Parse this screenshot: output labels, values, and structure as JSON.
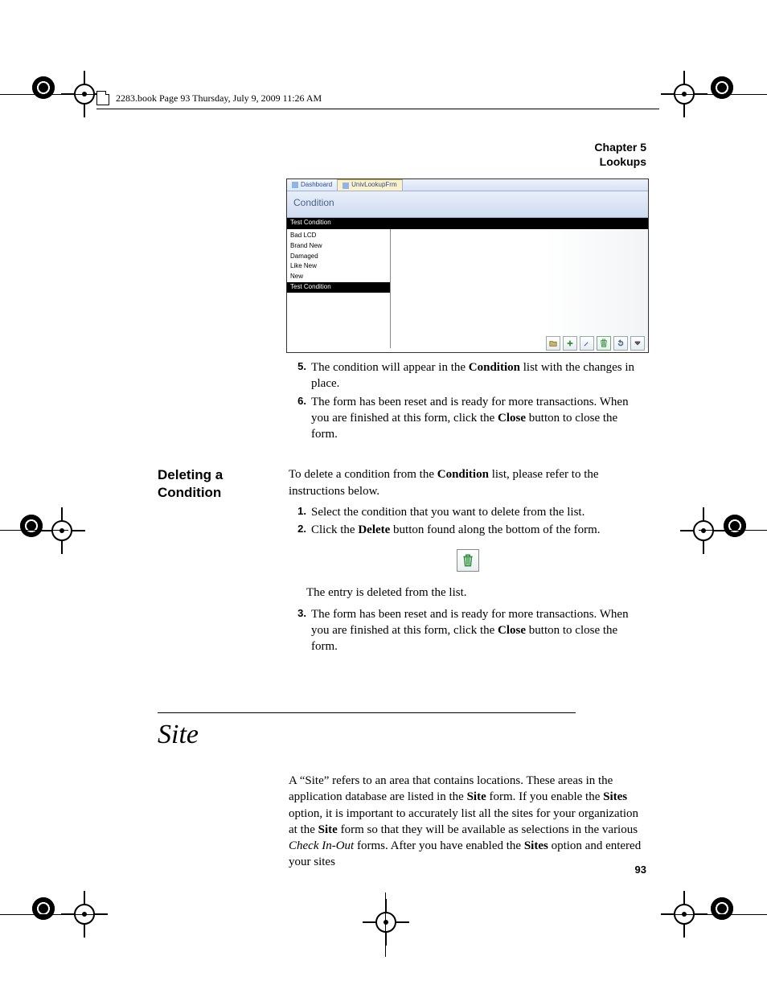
{
  "header": {
    "runninghead": "2283.book  Page 93  Thursday, July 9, 2009  11:26 AM"
  },
  "chapter": {
    "line1": "Chapter 5",
    "line2": "Lookups"
  },
  "screenshot": {
    "tabs": [
      "Dashboard",
      "UnivLookupFrm"
    ],
    "title": "Condition",
    "selected_bar": "Test Condition",
    "items": [
      "Bad LCD",
      "Brand New",
      "Damaged",
      "Like New",
      "New",
      "Test Condition"
    ],
    "toolbar_icons": [
      "browse-icon",
      "add-icon",
      "edit-icon",
      "delete-icon",
      "undo-icon",
      "close-icon"
    ]
  },
  "steps_top": [
    {
      "num": "5.",
      "text_parts": [
        "The condition will appear in the ",
        "Condition",
        " list with the changes in place."
      ]
    },
    {
      "num": "6.",
      "text_parts": [
        "The form has been reset and is ready for more transactions. When you are finished at this form, click the ",
        "Close",
        " button to close the form."
      ]
    }
  ],
  "delete_section": {
    "heading": "Deleting a Condition",
    "intro_parts": [
      "To delete a condition from the ",
      "Condition",
      " list, please refer to the instructions below."
    ],
    "steps": [
      {
        "num": "1.",
        "text": "Select the condition that you want to delete from the list."
      },
      {
        "num": "2.",
        "text_parts": [
          "Click the ",
          "Delete",
          " button found along the bottom of the form."
        ]
      }
    ],
    "after_icon": "The entry is deleted from the list.",
    "step3": {
      "num": "3.",
      "text_parts": [
        "The form has been reset and is ready for more transactions. When you are finished at this form, click the ",
        "Close",
        " button to close the form."
      ]
    }
  },
  "site_section": {
    "title": "Site",
    "para_parts": [
      "A “Site” refers to an area that contains locations. These areas in the application database are listed in the ",
      "Site",
      " form. If you enable the ",
      "Sites",
      " option, it is important to accurately list all the sites for your organization at the ",
      "Site",
      " form so that they will be available as selections in the various ",
      "Check In-Out",
      " forms. After you have enabled the ",
      "Sites",
      " option and entered your sites"
    ]
  },
  "page_number": "93"
}
